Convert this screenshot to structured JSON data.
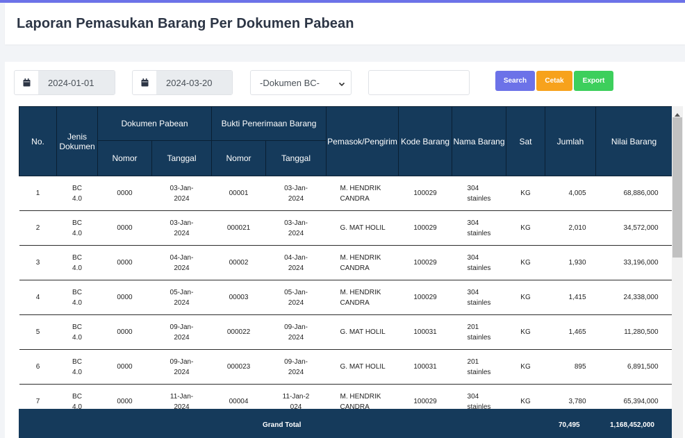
{
  "page": {
    "title": "Laporan Pemasukan Barang Per Dokumen Pabean"
  },
  "filters": {
    "date_from": "2024-01-01",
    "date_to": "2024-03-20",
    "dokumen_select": "-Dokumen BC-",
    "search_value": ""
  },
  "buttons": {
    "search": "Search",
    "cetak": "Cetak",
    "export": "Export"
  },
  "colors": {
    "header_bg": "#153a5b",
    "search": "#6c72e8",
    "cetak": "#f7a21c",
    "export": "#3dcf5c"
  },
  "table": {
    "headers": {
      "no": "No.",
      "jenis": "Jenis Dokumen",
      "dokumen_pabean": "Dokumen Pabean",
      "bukti": "Bukti Penerimaan Barang",
      "nomor": "Nomor",
      "tanggal": "Tanggal",
      "pemasok": "Pemasok/Pengirim",
      "kode": "Kode Barang",
      "nama": "Nama Barang",
      "sat": "Sat",
      "jumlah": "Jumlah",
      "nilai": "Nilai Barang"
    },
    "rows": [
      {
        "no": "1",
        "jenis": "BC 4.0",
        "nomor_dok": "0000",
        "tgl_dok": "03-Jan-2024",
        "nomor_bukti": "00001",
        "tgl_bukti": "03-Jan-2024",
        "pemasok": "M. HENDRIK CANDRA",
        "kode": "100029",
        "nama": "304 stainles",
        "sat": "KG",
        "jumlah": "4,005",
        "nilai": "68,886,000"
      },
      {
        "no": "2",
        "jenis": "BC 4.0",
        "nomor_dok": "0000",
        "tgl_dok": "03-Jan-2024",
        "nomor_bukti": "000021",
        "tgl_bukti": "03-Jan-2024",
        "pemasok": "G. MAT HOLIL",
        "kode": "100029",
        "nama": "304 stainles",
        "sat": "KG",
        "jumlah": "2,010",
        "nilai": "34,572,000"
      },
      {
        "no": "3",
        "jenis": "BC 4.0",
        "nomor_dok": "0000",
        "tgl_dok": "04-Jan-2024",
        "nomor_bukti": "00002",
        "tgl_bukti": "04-Jan-2024",
        "pemasok": "M. HENDRIK CANDRA",
        "kode": "100029",
        "nama": "304 stainles",
        "sat": "KG",
        "jumlah": "1,930",
        "nilai": "33,196,000"
      },
      {
        "no": "4",
        "jenis": "BC 4.0",
        "nomor_dok": "0000",
        "tgl_dok": "05-Jan-2024",
        "nomor_bukti": "00003",
        "tgl_bukti": "05-Jan-2024",
        "pemasok": "M. HENDRIK CANDRA",
        "kode": "100029",
        "nama": "304 stainles",
        "sat": "KG",
        "jumlah": "1,415",
        "nilai": "24,338,000"
      },
      {
        "no": "5",
        "jenis": "BC 4.0",
        "nomor_dok": "0000",
        "tgl_dok": "09-Jan-2024",
        "nomor_bukti": "000022",
        "tgl_bukti": "09-Jan-2024",
        "pemasok": "G. MAT HOLIL",
        "kode": "100031",
        "nama": "201 stainles",
        "sat": "KG",
        "jumlah": "1,465",
        "nilai": "11,280,500"
      },
      {
        "no": "6",
        "jenis": "BC 4.0",
        "nomor_dok": "0000",
        "tgl_dok": "09-Jan-2024",
        "nomor_bukti": "000023",
        "tgl_bukti": "09-Jan-2024",
        "pemasok": "G. MAT HOLIL",
        "kode": "100031",
        "nama": "201 stainles",
        "sat": "KG",
        "jumlah": "895",
        "nilai": "6,891,500"
      },
      {
        "no": "7",
        "jenis": "BC 4.0",
        "nomor_dok": "0000",
        "tgl_dok": "11-Jan-2024",
        "nomor_bukti": "00004",
        "tgl_bukti": "11-Jan-2024",
        "pemasok": "M. HENDRIK CANDRA",
        "kode": "100029",
        "nama": "304 stainles",
        "sat": "KG",
        "jumlah": "3,780",
        "nilai": "65,394,000"
      }
    ],
    "footer": {
      "label": "Grand Total",
      "jumlah": "70,495",
      "nilai": "1,168,452,000"
    }
  }
}
